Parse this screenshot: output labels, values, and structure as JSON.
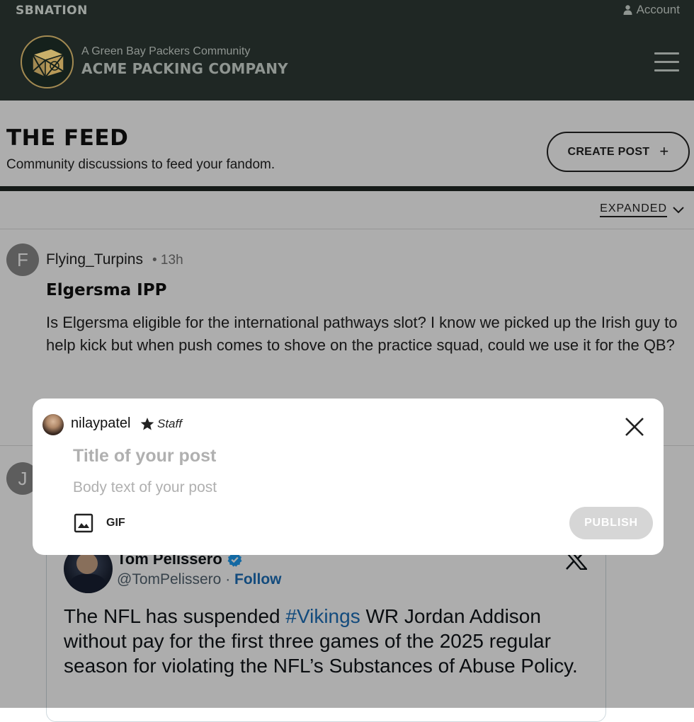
{
  "topbar": {
    "network": "SBNATION",
    "account_label": "Account",
    "community_tagline": "A Green Bay Packers Community",
    "site_name": "ACME PACKING COMPANY"
  },
  "feed": {
    "title": "THE FEED",
    "subtitle": "Community discussions to feed your fandom.",
    "create_label": "CREATE POST",
    "create_icon": "+",
    "view_mode": "EXPANDED"
  },
  "posts": [
    {
      "avatar_letter": "F",
      "author": "Flying_Turpins",
      "time": "• 13h",
      "title": "Elgersma IPP",
      "body": "Is Elgersma eligible for the international pathways slot? I know we picked up the Irish guy to help kick but when push comes to shove on the practice squad, could we use it for the QB?"
    },
    {
      "avatar_letter": "J"
    }
  ],
  "tweet": {
    "name": "Tom Pelissero",
    "handle": "@TomPelissero",
    "separator": " · ",
    "follow": "Follow",
    "text_before": "The NFL has suspended ",
    "hashtag": "#Vikings",
    "text_after": " WR Jordan Addison without pay for the first three games of the 2025 regular season for violating the NFL’s Substances of Abuse Policy."
  },
  "composer": {
    "username": "nilaypatel",
    "role": "Staff",
    "title_placeholder": "Title of your post",
    "body_placeholder": "Body text of your post",
    "gif_label": "GIF",
    "publish_label": "PUBLISH"
  },
  "colors": {
    "header_bg": "#1f2724",
    "logo_gold": "#a38a52",
    "link_blue": "#1d6fb8",
    "publish_disabled": "#d6d6d6"
  },
  "icons": [
    "user-icon",
    "menu-icon",
    "plus-icon",
    "chevron-down-icon",
    "verified-badge-icon",
    "x-logo-icon",
    "star-icon",
    "close-icon",
    "image-icon"
  ]
}
